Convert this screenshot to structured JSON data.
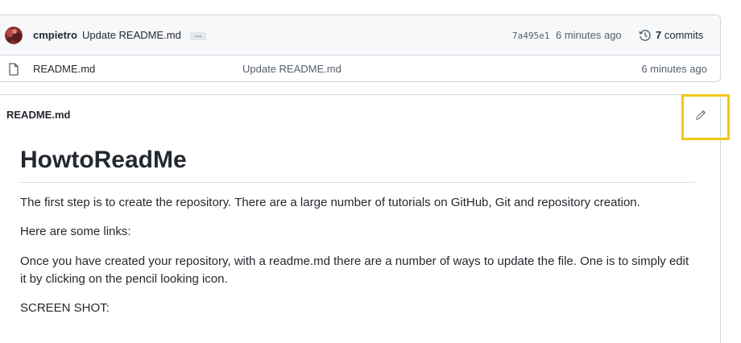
{
  "latest_commit": {
    "author": "cmpietro",
    "message": "Update README.md",
    "more_label": "…",
    "sha": "7a495e1",
    "time": "6 minutes ago",
    "commits_count": "7",
    "commits_label": "commits"
  },
  "files": [
    {
      "name": "README.md",
      "commit_message": "Update README.md",
      "time": "6 minutes ago"
    }
  ],
  "readme": {
    "title": "README.md",
    "heading": "HowtoReadMe",
    "paragraphs": [
      "The first step is to create the repository. There are a large number of tutorials on GitHub, Git and repository creation.",
      "Here are some links:",
      "Once you have created your repository, with a readme.md there are a number of ways to update the file. One is to simply edit it by clicking on the pencil looking icon.",
      "SCREEN SHOT:"
    ]
  },
  "icons": {
    "avatar": "avatar",
    "history": "history-icon",
    "file": "file-icon",
    "edit": "pencil-icon"
  },
  "colors": {
    "highlight": "#f5c518",
    "border": "#d0d7de",
    "header_bg": "#f6f8fa",
    "muted_text": "#57606a"
  }
}
